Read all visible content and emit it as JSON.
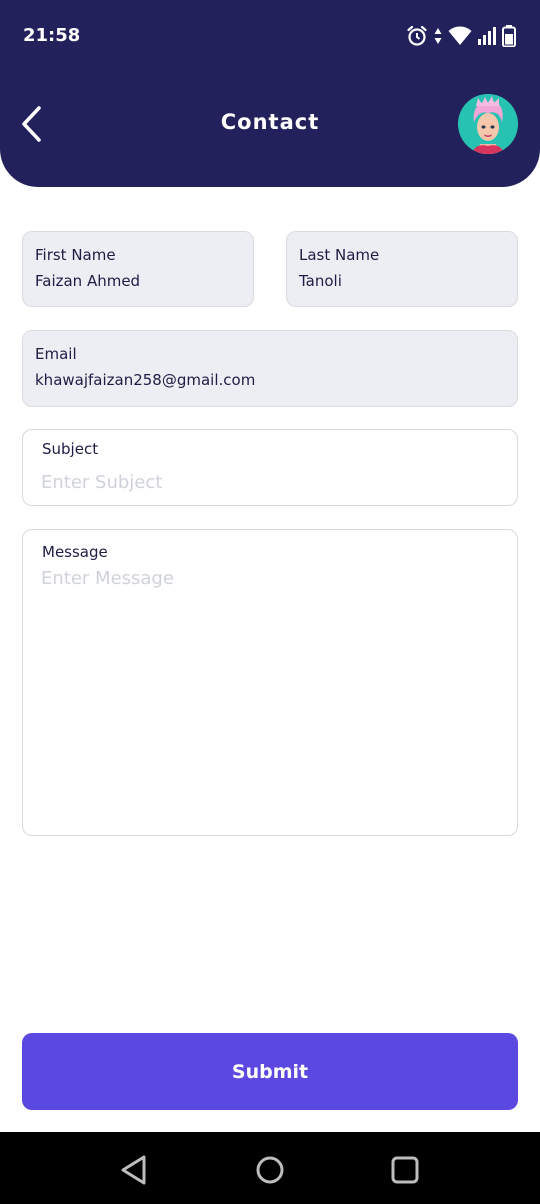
{
  "status_bar": {
    "time": "21:58",
    "icons": [
      "alarm-icon",
      "data-arrows-icon",
      "wifi-icon",
      "signal-icon",
      "battery-icon"
    ]
  },
  "header": {
    "title": "Contact",
    "back_icon": "chevron-left-icon",
    "avatar": "profile-avatar"
  },
  "form": {
    "first_name": {
      "label": "First Name",
      "value": "Faizan Ahmed"
    },
    "last_name": {
      "label": "Last Name",
      "value": "Tanoli"
    },
    "email": {
      "label": "Email",
      "value": "khawajfaizan258@gmail.com"
    },
    "subject": {
      "label": "Subject",
      "placeholder": "Enter Subject",
      "value": ""
    },
    "message": {
      "label": "Message",
      "placeholder": "Enter Message",
      "value": ""
    }
  },
  "submit": {
    "label": "Submit"
  },
  "nav_bar": {
    "buttons": [
      "back-triangle-icon",
      "home-circle-icon",
      "recents-square-icon"
    ]
  },
  "colors": {
    "header_bg": "#22215b",
    "accent": "#5b48e0",
    "field_bg": "#eceef3",
    "text": "#1d1d45",
    "placeholder": "#cfd2d8"
  }
}
